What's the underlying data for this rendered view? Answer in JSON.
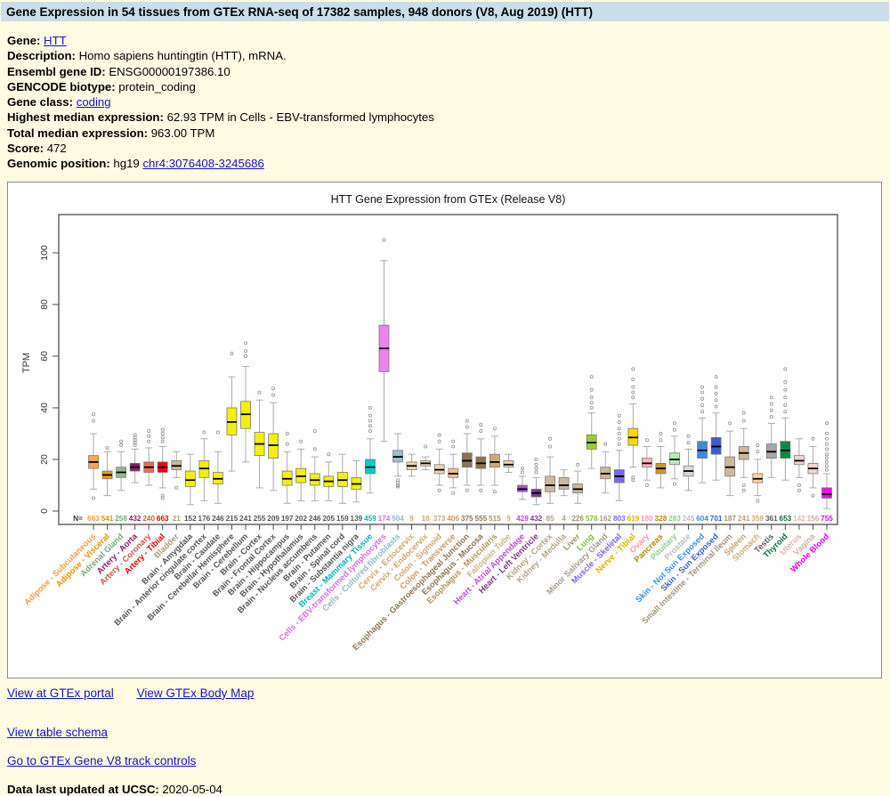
{
  "page": {
    "title_bar": "Gene Expression in 54 tissues from GTEx RNA-seq of 17382 samples, 948 donors (V8, Aug 2019) (HTT)"
  },
  "info": [
    {
      "label": "Gene:",
      "prefix": "",
      "value": "HTT",
      "link": true
    },
    {
      "label": "Description:",
      "prefix": "",
      "value": "Homo sapiens huntingtin (HTT), mRNA.",
      "link": false
    },
    {
      "label": "Ensembl gene ID:",
      "prefix": "",
      "value": "ENSG00000197386.10",
      "link": false
    },
    {
      "label": "GENCODE biotype:",
      "prefix": "",
      "value": "protein_coding",
      "link": false
    },
    {
      "label": "Gene class:",
      "prefix": "",
      "value": "coding",
      "link": true
    },
    {
      "label": "Highest median expression:",
      "prefix": "",
      "value": "62.93 TPM in Cells - EBV-transformed lymphocytes",
      "link": false
    },
    {
      "label": "Total median expression:",
      "prefix": "",
      "value": "963.00 TPM",
      "link": false
    },
    {
      "label": "Score:",
      "prefix": "",
      "value": "472",
      "link": false
    },
    {
      "label": "Genomic position:",
      "prefix": "hg19 ",
      "value": "chr4:3076408-3245686",
      "link": true
    }
  ],
  "footer": {
    "gtex_portal": "View at GTEx portal",
    "body_map": "View GTEx Body Map",
    "table_schema": "View table schema",
    "track_controls": "Go to GTEx Gene V8 track controls",
    "updated_label": "Data last updated at UCSC:",
    "updated_value": "2020-05-04"
  },
  "chart_data": {
    "type": "boxplot",
    "title": "HTT Gene Expression from GTEx (Release V8)",
    "ylabel": "TPM",
    "ylim": [
      0,
      112
    ],
    "yticks": [
      0,
      20,
      40,
      60,
      80,
      100
    ],
    "grid": false,
    "n_label": "N=",
    "tissues": [
      {
        "label": "Adipose - Subcutaneous",
        "n": 663,
        "color": "#FFA54F",
        "label_color": "#ED9E4E",
        "stats": [
          8.5,
          16.5,
          19,
          21.5,
          30
        ],
        "outliers": [
          35,
          37.5,
          5
        ]
      },
      {
        "label": "Adipose - Visceral",
        "n": 541,
        "color": "#EE9A00",
        "label_color": "#E09200",
        "stats": [
          6,
          12.5,
          14,
          15.5,
          23
        ],
        "outliers": [
          24.5
        ]
      },
      {
        "label": "Adrenal Gland",
        "n": 258,
        "color": "#8FBC8F",
        "label_color": "#74A874",
        "stats": [
          8,
          13,
          15,
          17,
          23
        ],
        "outliers": [
          25.5,
          27
        ]
      },
      {
        "label": "Artery - Aorta",
        "n": 432,
        "color": "#8B1C62",
        "label_color": "#8B1C62",
        "stats": [
          11,
          15.5,
          17,
          18.5,
          24
        ],
        "outliers": [
          25.5,
          26.5,
          27.5,
          28.5,
          29.5
        ]
      },
      {
        "label": "Artery - Coronary",
        "n": 240,
        "color": "#EE6A50",
        "label_color": "#C85A44",
        "stats": [
          10,
          15,
          17,
          19,
          24.5
        ],
        "outliers": [
          27,
          29,
          31
        ]
      },
      {
        "label": "Artery - Tibial",
        "n": 663,
        "color": "#FF0000",
        "label_color": "#E60000",
        "stats": [
          9,
          15,
          17,
          19,
          25
        ],
        "outliers": [
          27,
          28.5,
          30,
          31.5,
          6,
          5
        ]
      },
      {
        "label": "Bladder",
        "n": 21,
        "color": "#CDB79E",
        "label_color": "#AE9A78",
        "stats": [
          13,
          16,
          17.5,
          19.5,
          23
        ],
        "outliers": [
          9
        ]
      },
      {
        "label": "Brain - Amygdala",
        "n": 152,
        "color": "#F2F200",
        "label_color": "#545454",
        "stats": [
          2.5,
          9.5,
          12,
          15.5,
          22
        ],
        "outliers": []
      },
      {
        "label": "Brain - Anterior cingulate cortex",
        "n": 176,
        "color": "#F2F200",
        "label_color": "#545454",
        "stats": [
          4,
          13,
          16.5,
          19.5,
          28
        ],
        "outliers": [
          30.5
        ]
      },
      {
        "label": "Brain - Caudate",
        "n": 246,
        "color": "#F2F200",
        "label_color": "#545454",
        "stats": [
          3,
          10.5,
          12.5,
          15,
          23
        ],
        "outliers": [
          30.5
        ]
      },
      {
        "label": "Brain - Cerebellar Hemisphere",
        "n": 215,
        "color": "#F2F200",
        "label_color": "#545454",
        "stats": [
          15.5,
          29.5,
          34.5,
          40,
          52
        ],
        "outliers": [
          61
        ]
      },
      {
        "label": "Brain - Cerebellum",
        "n": 241,
        "color": "#F2F200",
        "label_color": "#545454",
        "stats": [
          19,
          32,
          37.5,
          42.5,
          56
        ],
        "outliers": [
          60,
          62,
          65
        ]
      },
      {
        "label": "Brain - Cortex",
        "n": 255,
        "color": "#F2F200",
        "label_color": "#545454",
        "stats": [
          9,
          21.5,
          26,
          30.5,
          43
        ],
        "outliers": [
          46
        ]
      },
      {
        "label": "Brain - Frontal Cortex",
        "n": 209,
        "color": "#F2F200",
        "label_color": "#545454",
        "stats": [
          8,
          20.5,
          25.5,
          30,
          42
        ],
        "outliers": [
          45,
          47.5
        ]
      },
      {
        "label": "Brain - Hippocampus",
        "n": 197,
        "color": "#F2F200",
        "label_color": "#545454",
        "stats": [
          3,
          10,
          12.5,
          15.5,
          23
        ],
        "outliers": [
          26,
          30
        ]
      },
      {
        "label": "Brain - Hypothalamus",
        "n": 202,
        "color": "#F2F200",
        "label_color": "#545454",
        "stats": [
          4,
          11,
          13.5,
          16.5,
          24
        ],
        "outliers": [
          27
        ]
      },
      {
        "label": "Brain - Nucleus accumbens",
        "n": 246,
        "color": "#F2F200",
        "label_color": "#545454",
        "stats": [
          4,
          10,
          12,
          14.5,
          21
        ],
        "outliers": [
          24,
          31
        ]
      },
      {
        "label": "Brain - Putamen",
        "n": 205,
        "color": "#F2F200",
        "label_color": "#545454",
        "stats": [
          4,
          9.5,
          11.5,
          13.5,
          19
        ],
        "outliers": [
          22
        ]
      },
      {
        "label": "Brain - Spinal cord",
        "n": 159,
        "color": "#F2F200",
        "label_color": "#545454",
        "stats": [
          3,
          9.5,
          12,
          15,
          22
        ],
        "outliers": []
      },
      {
        "label": "Brain - Substantia nigra",
        "n": 139,
        "color": "#F2F200",
        "label_color": "#545454",
        "stats": [
          3.5,
          8.5,
          10.5,
          13,
          19.5
        ],
        "outliers": []
      },
      {
        "label": "Breast - Mammary Tissue",
        "n": 459,
        "color": "#00CDCD",
        "label_color": "#00B3B3",
        "stats": [
          7,
          14.5,
          17,
          20,
          28
        ],
        "outliers": [
          31,
          33,
          35,
          37,
          40
        ]
      },
      {
        "label": "Cells - EBV-transformed lymphocytes",
        "n": 174,
        "color": "#EE82EE",
        "label_color": "#D66FD6",
        "stats": [
          27,
          54,
          63,
          72,
          97
        ],
        "outliers": [
          105
        ]
      },
      {
        "label": "Cells - Cultured fibroblasts",
        "n": 504,
        "color": "#9AC0CD",
        "label_color": "#93B7C4",
        "stats": [
          13.5,
          19,
          21,
          23.5,
          30
        ],
        "outliers": [
          12,
          11,
          10,
          9.5
        ]
      },
      {
        "label": "Cervix - Ectocervix",
        "n": 9,
        "color": "#EED8AE",
        "label_color": "#C9A96E",
        "stats": [
          13.5,
          16,
          17.5,
          19,
          22
        ],
        "outliers": []
      },
      {
        "label": "Cervix - Endocervix",
        "n": 10,
        "color": "#EED8AE",
        "label_color": "#C9A96E",
        "stats": [
          16,
          17.5,
          18.5,
          19.5,
          21
        ],
        "outliers": [
          25
        ]
      },
      {
        "label": "Colon - Sigmoid",
        "n": 373,
        "color": "#EED5B7",
        "label_color": "#CBA77C",
        "stats": [
          10,
          14.5,
          16,
          18,
          24
        ],
        "outliers": [
          27,
          29.5,
          8
        ]
      },
      {
        "label": "Colon - Transverse",
        "n": 406,
        "color": "#EEC591",
        "label_color": "#C39A68",
        "stats": [
          9,
          13,
          14.5,
          16.5,
          22
        ],
        "outliers": [
          25,
          27,
          7
        ]
      },
      {
        "label": "Esophagus - Gastroesophageal Junction",
        "n": 375,
        "color": "#8B7355",
        "label_color": "#8B7355",
        "stats": [
          10,
          17,
          19.5,
          22.5,
          30
        ],
        "outliers": [
          32.5,
          35,
          8
        ]
      },
      {
        "label": "Esophagus - Mucosa",
        "n": 555,
        "color": "#8B7355",
        "label_color": "#8B7355",
        "stats": [
          10,
          16.5,
          18.5,
          21,
          28
        ],
        "outliers": [
          31,
          33.5,
          8
        ]
      },
      {
        "label": "Esophagus - Muscularis",
        "n": 515,
        "color": "#CDAA7D",
        "label_color": "#B2905F",
        "stats": [
          10,
          17,
          19,
          22,
          29
        ],
        "outliers": [
          32,
          7.5
        ]
      },
      {
        "label": "Fallopian Tube",
        "n": 9,
        "color": "#EED8AE",
        "label_color": "#CBB488",
        "stats": [
          15,
          17,
          18,
          19.5,
          22
        ],
        "outliers": []
      },
      {
        "label": "Heart - Atrial Appendage",
        "n": 429,
        "color": "#B452CD",
        "label_color": "#B452CD",
        "stats": [
          4.5,
          7.5,
          8.5,
          10,
          13.5
        ],
        "outliers": [
          15,
          16.5
        ]
      },
      {
        "label": "Heart - Left Ventricle",
        "n": 432,
        "color": "#7A378B",
        "label_color": "#7A378B",
        "stats": [
          2.5,
          5.5,
          7,
          8.5,
          13
        ],
        "outliers": [
          15,
          16.5,
          18,
          20
        ]
      },
      {
        "label": "Kidney - Cortex",
        "n": 85,
        "color": "#CDB79E",
        "label_color": "#B5A287",
        "stats": [
          3,
          7.5,
          10,
          13.5,
          21
        ],
        "outliers": [
          25,
          28
        ]
      },
      {
        "label": "Kidney - Medulla",
        "n": 4,
        "color": "#CDB79E",
        "label_color": "#B5A287",
        "stats": [
          6,
          8.5,
          10,
          13,
          16
        ],
        "outliers": []
      },
      {
        "label": "Liver",
        "n": 226,
        "color": "#CDB79E",
        "label_color": "#A98D6E",
        "stats": [
          3,
          7,
          8.5,
          10.5,
          15.5
        ],
        "outliers": [
          18
        ]
      },
      {
        "label": "Lung",
        "n": 578,
        "color": "#9ACD32",
        "label_color": "#7FBE33",
        "stats": [
          16.5,
          24,
          26.5,
          29.5,
          38
        ],
        "outliers": [
          40,
          42,
          44,
          47,
          52
        ]
      },
      {
        "label": "Minor Salivary Gland",
        "n": 162,
        "color": "#CDB79E",
        "label_color": "#A6988A",
        "stats": [
          7,
          12.5,
          14.5,
          17,
          23
        ],
        "outliers": [
          26
        ]
      },
      {
        "label": "Muscle - Skeletal",
        "n": 803,
        "color": "#7A67EE",
        "label_color": "#7A67EE",
        "stats": [
          4,
          11,
          13.5,
          16,
          23.5
        ],
        "outliers": [
          26,
          28,
          30,
          32,
          34.5,
          37
        ]
      },
      {
        "label": "Nerve - Tibial",
        "n": 619,
        "color": "#FFD700",
        "label_color": "#D4B500",
        "stats": [
          17,
          25.5,
          28.5,
          32,
          41.5
        ],
        "outliers": [
          44,
          46,
          48,
          51,
          55,
          13,
          12
        ]
      },
      {
        "label": "Ovary",
        "n": 180,
        "color": "#FFB6C1",
        "label_color": "#EE9AAC",
        "stats": [
          12,
          17,
          18.5,
          20.5,
          25
        ],
        "outliers": [
          27.5,
          10
        ]
      },
      {
        "label": "Pancreas",
        "n": 328,
        "color": "#CD9B1D",
        "label_color": "#B8860B",
        "stats": [
          9,
          14.5,
          16.5,
          18.5,
          25
        ],
        "outliers": [
          27.5,
          30
        ]
      },
      {
        "label": "Pituitary",
        "n": 283,
        "color": "#B4EEB4",
        "label_color": "#8FCE8F",
        "stats": [
          12.5,
          18,
          20,
          22.5,
          29
        ],
        "outliers": [
          31.5,
          34,
          10.5
        ]
      },
      {
        "label": "Prostate",
        "n": 245,
        "color": "#D9D9D9",
        "label_color": "#BDBDBD",
        "stats": [
          8,
          13.5,
          15.5,
          17.5,
          24
        ],
        "outliers": [
          26.5,
          29
        ]
      },
      {
        "label": "Skin - Not Sun Exposed",
        "n": 604,
        "color": "#3A8EDE",
        "label_color": "#3A8EDE",
        "stats": [
          11,
          20.5,
          23.5,
          27,
          36
        ],
        "outliers": [
          38.5,
          41,
          43.5,
          46,
          48
        ]
      },
      {
        "label": "Skin - Sun Exposed",
        "n": 701,
        "color": "#3A5FCD",
        "label_color": "#3A5FCD",
        "stats": [
          12,
          22,
          25,
          28.5,
          38
        ],
        "outliers": [
          40.5,
          43,
          45.5,
          48,
          52
        ]
      },
      {
        "label": "Small Intestine - Terminal Ileum",
        "n": 187,
        "color": "#CDB79E",
        "label_color": "#A59179",
        "stats": [
          6,
          13.5,
          17,
          21,
          31
        ],
        "outliers": [
          34
        ]
      },
      {
        "label": "Spleen",
        "n": 241,
        "color": "#CDB79E",
        "label_color": "#C3A277",
        "stats": [
          13,
          20,
          22.5,
          25,
          32
        ],
        "outliers": [
          35,
          38,
          10,
          8
        ]
      },
      {
        "label": "Stomach",
        "n": 359,
        "color": "#FFD39B",
        "label_color": "#D2A876",
        "stats": [
          6,
          11,
          12.5,
          14.5,
          20
        ],
        "outliers": [
          23,
          25.5,
          4
        ]
      },
      {
        "label": "Testis",
        "n": 361,
        "color": "#A6A6A6",
        "label_color": "#5E5E5E",
        "stats": [
          13,
          20.5,
          23,
          26,
          34
        ],
        "outliers": [
          36.5,
          39,
          41.5,
          44
        ]
      },
      {
        "label": "Thyroid",
        "n": 653,
        "color": "#008B45",
        "label_color": "#106B3C",
        "stats": [
          12,
          20.5,
          23.5,
          27,
          36
        ],
        "outliers": [
          38.5,
          41,
          44,
          47,
          50,
          55
        ]
      },
      {
        "label": "Uterus",
        "n": 142,
        "color": "#EED5D2",
        "label_color": "#D8B7B4",
        "stats": [
          13,
          18,
          19.5,
          21.5,
          28
        ],
        "outliers": [
          10,
          8
        ]
      },
      {
        "label": "Vagina",
        "n": 156,
        "color": "#EED5D2",
        "label_color": "#D3ABA4",
        "stats": [
          9,
          14.5,
          16.5,
          18.5,
          25
        ],
        "outliers": [
          28,
          6
        ]
      },
      {
        "label": "Whole Blood",
        "n": 755,
        "color": "#FF00FF",
        "label_color": "#EE00EE",
        "stats": [
          1,
          5,
          6.5,
          9,
          14.5
        ],
        "outliers": [
          16,
          17.5,
          19,
          20.5,
          22,
          24,
          26,
          28,
          30,
          34
        ]
      }
    ]
  }
}
